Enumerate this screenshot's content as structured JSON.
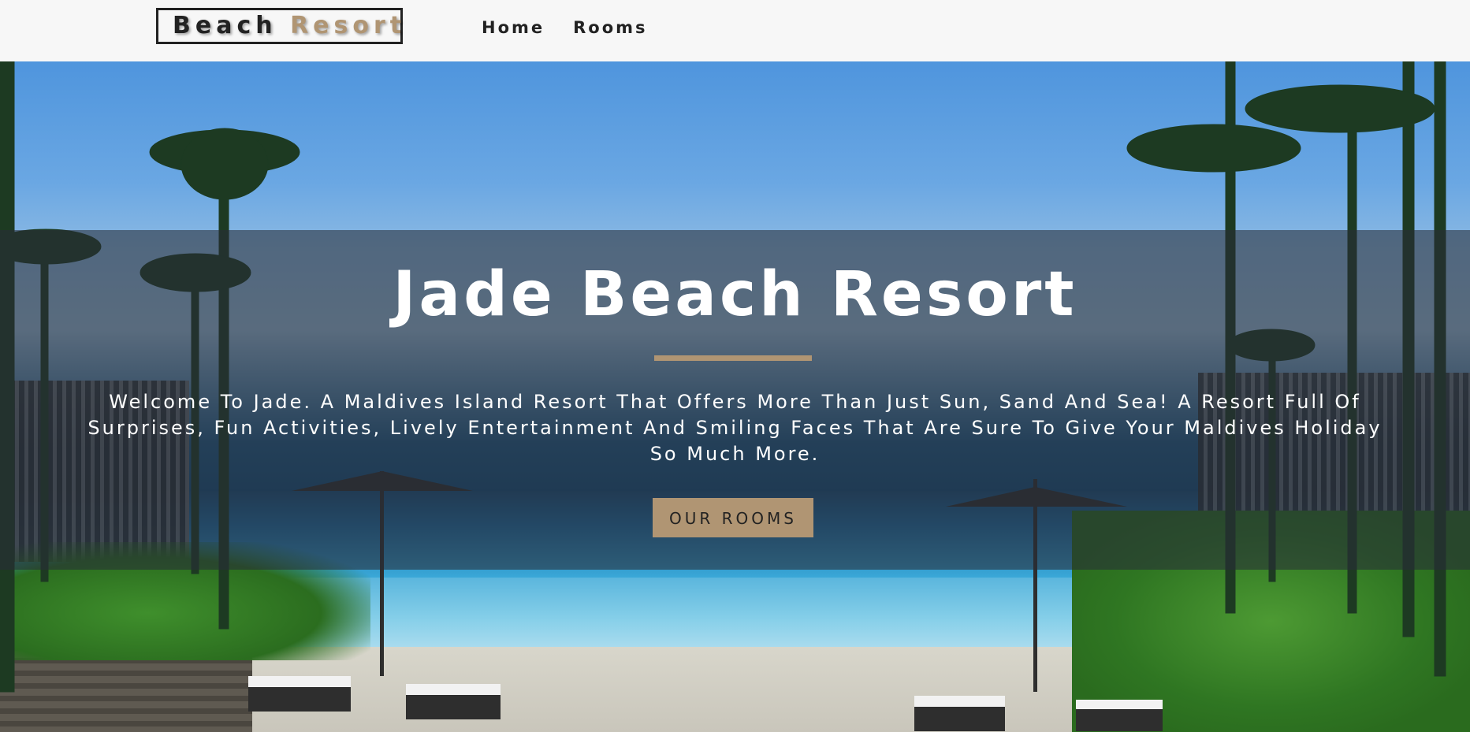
{
  "navbar": {
    "logo": {
      "part1": "Beach",
      "part2": "Resort"
    },
    "links": [
      {
        "label": "Home"
      },
      {
        "label": "Rooms"
      }
    ]
  },
  "hero": {
    "title": "Jade Beach Resort",
    "subtitle": "Welcome To Jade. A Maldives Island Resort That Offers More Than Just Sun, Sand And Sea! A Resort Full Of Surprises, Fun Activities, Lively Entertainment And Smiling Faces That Are Sure To Give Your Maldives Holiday So Much More.",
    "cta_label": "OUR ROOMS",
    "background_image": "infinity-pool-with-palm-trees-and-sea-view"
  },
  "colors": {
    "accent": "#b09573",
    "navbar_bg": "#f7f7f7",
    "text_dark": "#222222",
    "overlay": "rgba(40,45,55,0.58)"
  }
}
